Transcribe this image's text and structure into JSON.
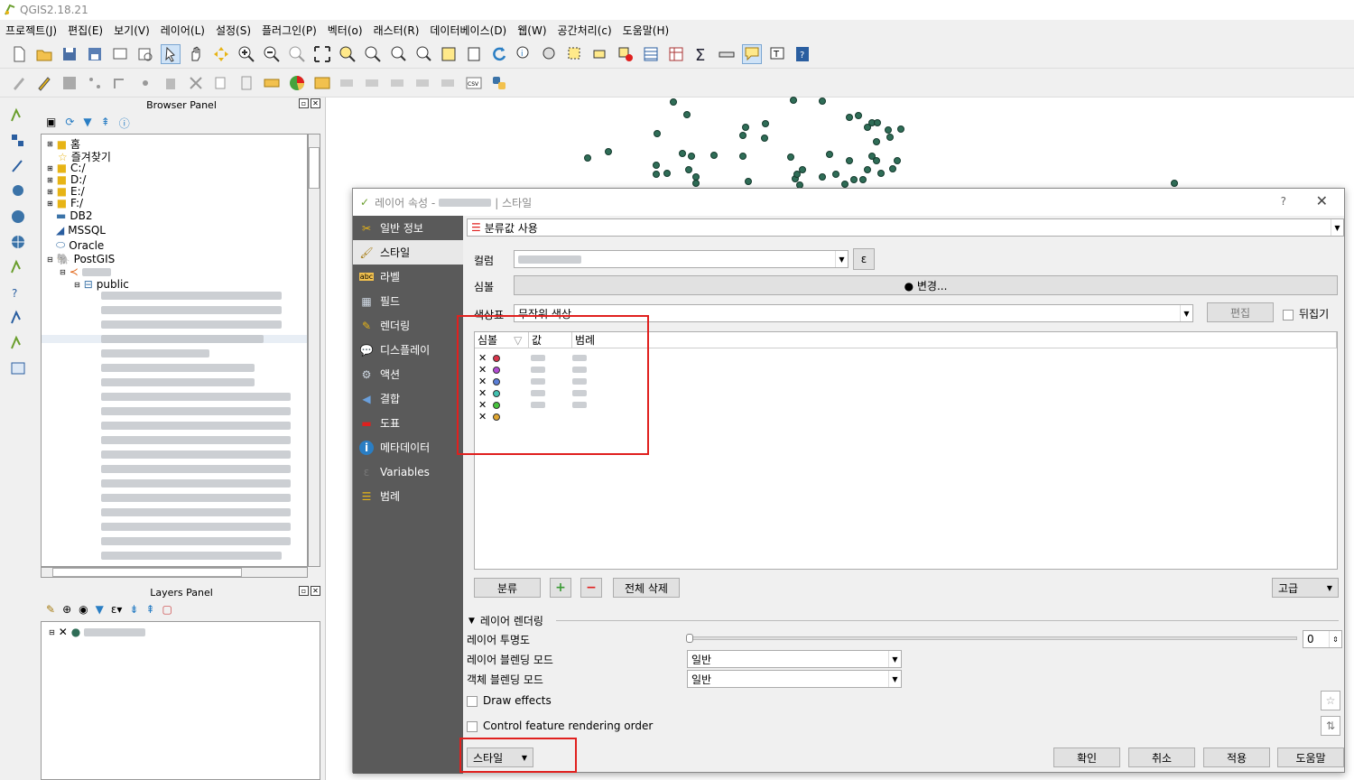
{
  "app": {
    "title": "QGIS2.18.21"
  },
  "menu": [
    "프로젝트(J)",
    "편집(E)",
    "보기(V)",
    "레이어(L)",
    "설정(S)",
    "플러그인(P)",
    "벡터(o)",
    "래스터(R)",
    "데이터베이스(D)",
    "웹(W)",
    "공간처리(c)",
    "도움말(H)"
  ],
  "browser": {
    "title": "Browser Panel",
    "items": [
      "홈",
      "즐겨찾기",
      "C:/",
      "D:/",
      "E:/",
      "F:/",
      "DB2",
      "MSSQL",
      "Oracle",
      "PostGIS",
      "public"
    ]
  },
  "layers": {
    "title": "Layers Panel"
  },
  "dialog": {
    "title": "레이어 속성 - ",
    "title_suffix": "| 스타일",
    "help": "?",
    "close": "✕",
    "sidebar": [
      "일반 정보",
      "스타일",
      "라벨",
      "필드",
      "렌더링",
      "디스플레이",
      "액션",
      "결합",
      "도표",
      "메타데이터",
      "Variables",
      "범례"
    ],
    "renderer": "분류값 사용",
    "column_label": "컬럼",
    "symbol_label": "심볼",
    "change_button": "● 변경...",
    "colorramp_label": "색상표",
    "colorramp_value": "무작위 색상",
    "edit_button": "편집",
    "invert_label": "뒤집기",
    "table_headers": [
      "심볼",
      "값",
      "범례"
    ],
    "categories": [
      {
        "color": "#d9344a"
      },
      {
        "color": "#b34bd4"
      },
      {
        "color": "#5a7fd8"
      },
      {
        "color": "#42c2b0"
      },
      {
        "color": "#46c43c"
      },
      {
        "color": "#e0a630"
      }
    ],
    "classify_button": "분류",
    "add_icon": "plus-icon",
    "remove_icon": "minus-icon",
    "delete_all_button": "전체 삭제",
    "advanced_button": "고급",
    "section_title": "레이어 렌더링",
    "opacity_label": "레이어 투명도",
    "opacity_value": "0",
    "layer_blend_label": "레이어 블렌딩 모드",
    "layer_blend_value": "일반",
    "feature_blend_label": "객체 블렌딩 모드",
    "feature_blend_value": "일반",
    "draw_effects": "Draw effects",
    "control_order": "Control feature rendering order",
    "style_button": "스타일",
    "ok_button": "확인",
    "cancel_button": "취소",
    "apply_button": "적용",
    "help_button": "도움말"
  },
  "colors": {
    "accent": "#e0201e",
    "point_fill": "#2f6d57",
    "sidebar_bg": "#5a5a5a"
  }
}
